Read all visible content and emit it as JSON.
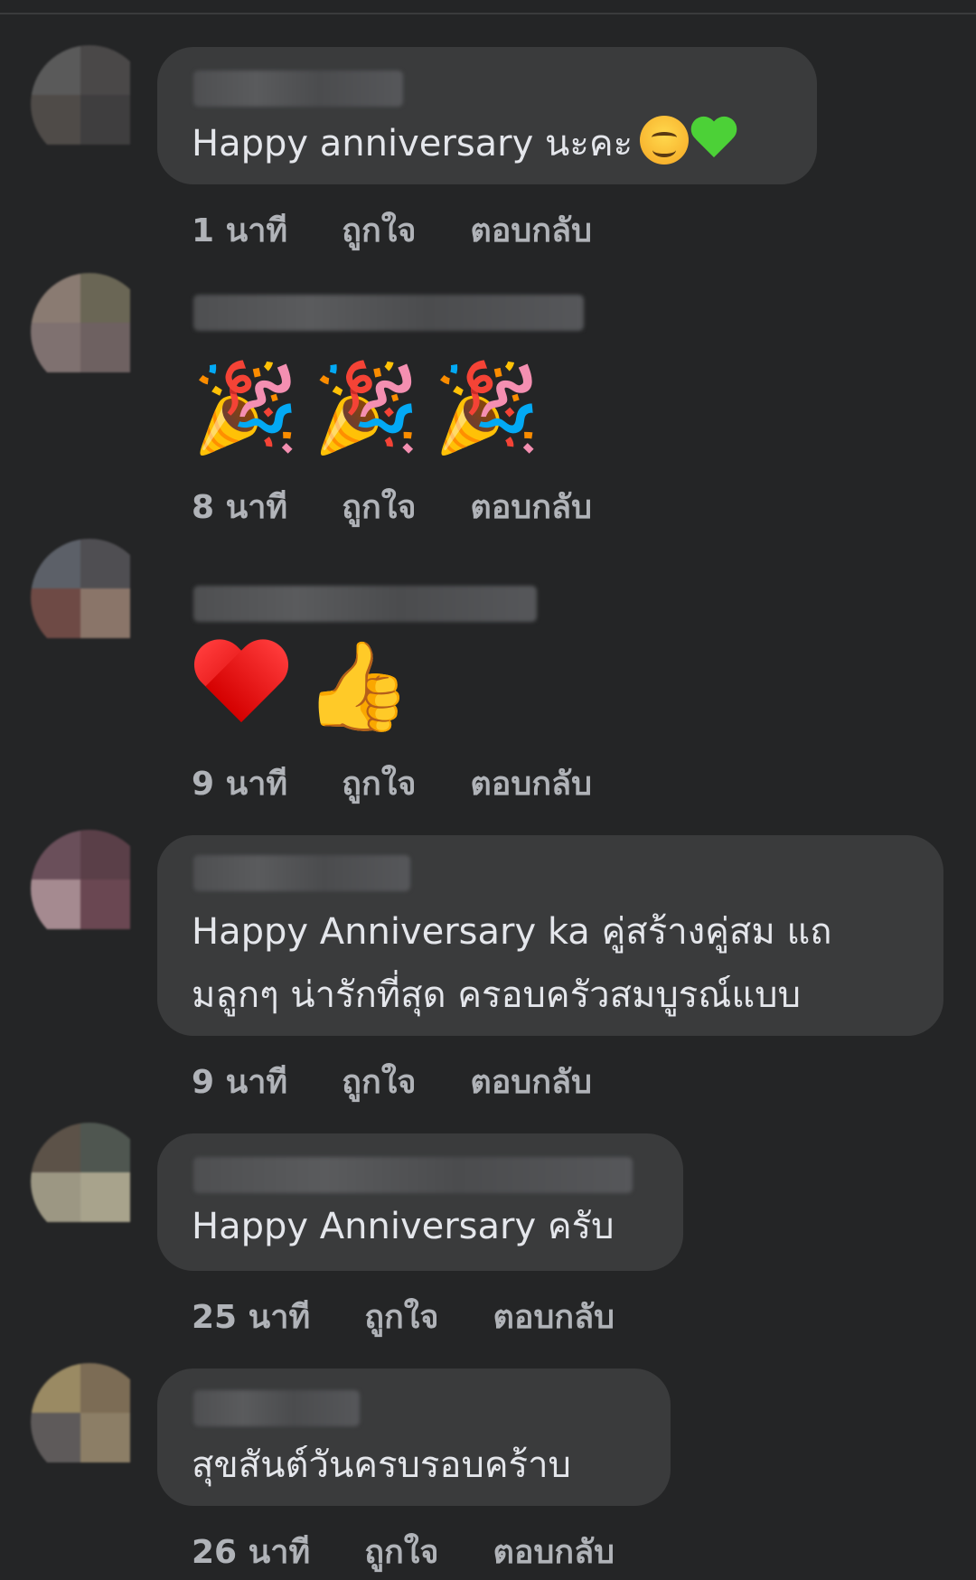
{
  "comments": [
    {
      "text": "Happy anniversary นะคะ",
      "emoji": [
        "smiling-face-icon",
        "green-heart-icon"
      ],
      "time": "1 นาที",
      "like": "ถูกใจ",
      "reply": "ตอบกลับ"
    },
    {
      "text": "",
      "emoji": [
        "party-popper-icon",
        "party-popper-icon",
        "party-popper-icon"
      ],
      "time": "8 นาที",
      "like": "ถูกใจ",
      "reply": "ตอบกลับ"
    },
    {
      "text": "",
      "emoji": [
        "red-heart-icon",
        "thumbs-up-icon"
      ],
      "time": "9 นาที",
      "like": "ถูกใจ",
      "reply": "ตอบกลับ"
    },
    {
      "text_line1": "Happy Anniversary ka คู่สร้างคู่สม แถ",
      "text_line2": "มลูกๆ น่ารักที่สุด ครอบครัวสมบูรณ์แบบ",
      "time": "9 นาที",
      "like": "ถูกใจ",
      "reply": "ตอบกลับ"
    },
    {
      "text": "Happy Anniversary ครับ",
      "time": "25 นาที",
      "like": "ถูกใจ",
      "reply": "ตอบกลับ"
    },
    {
      "text": "สุขสันต์วันครบรอบคร้าบ",
      "time": "26 นาที",
      "like": "ถูกใจ",
      "reply": "ตอบกลับ"
    }
  ],
  "emoji_glyphs": {
    "party": "🎉",
    "thumbs": "👍"
  },
  "colors": {
    "background": "#242526",
    "bubble": "#3a3b3c",
    "text": "#e4e6eb",
    "meta": "#b0b3b8"
  }
}
